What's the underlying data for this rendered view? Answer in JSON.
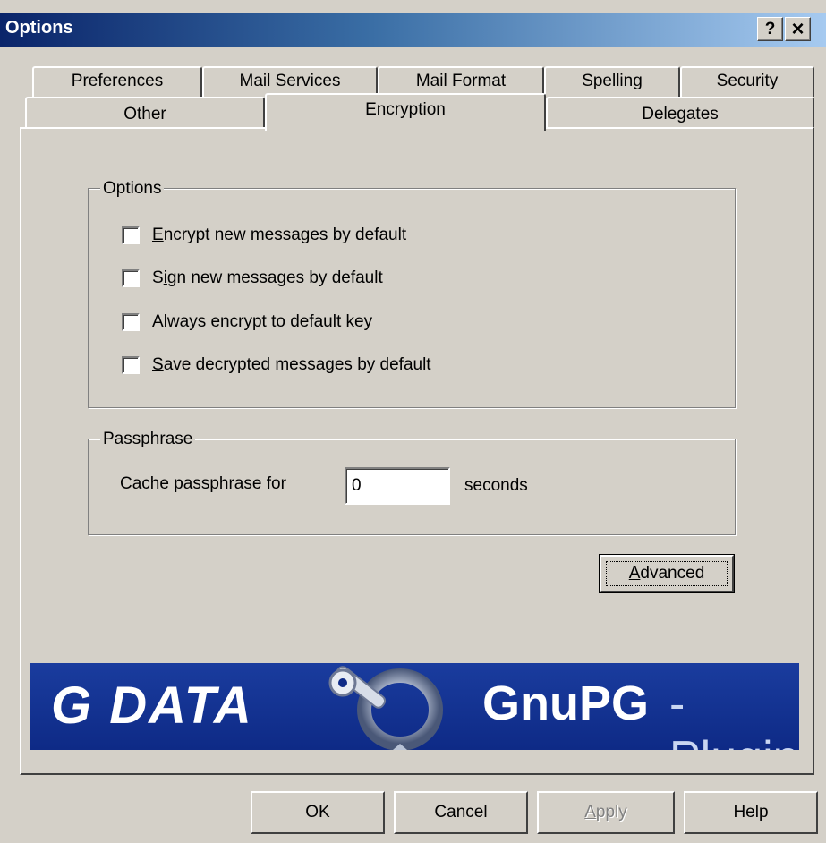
{
  "window": {
    "title": "Options",
    "help_btn": "?",
    "close_btn": "×"
  },
  "tabs_row1": [
    "Preferences",
    "Mail Services",
    "Mail Format",
    "Spelling",
    "Security"
  ],
  "tabs_row2": [
    "Other",
    "Encryption",
    "Delegates"
  ],
  "active_tab": "Encryption",
  "options_group": {
    "legend": "Options",
    "items": [
      {
        "mnemonic": "E",
        "rest": "ncrypt new messages by default",
        "pre": "",
        "checked": false
      },
      {
        "mnemonic": "i",
        "rest": "gn new messages by default",
        "pre": "S",
        "checked": false
      },
      {
        "mnemonic": "l",
        "rest": "ways encrypt to default key",
        "pre": "A",
        "checked": false
      },
      {
        "mnemonic": "S",
        "rest": "ave decrypted messages by default",
        "pre": "",
        "checked": false
      }
    ]
  },
  "passphrase_group": {
    "legend": "Passphrase",
    "cache_label_mnemonic": "C",
    "cache_label_rest": "ache passphrase for",
    "cache_value": "0",
    "unit_label": "seconds"
  },
  "advanced_button": {
    "mnemonic": "A",
    "rest": "dvanced"
  },
  "banner": {
    "left_text": "G DATA",
    "right_text_bold": "GnuPG",
    "right_text_light": "-Plugin"
  },
  "footer": {
    "ok": "OK",
    "cancel": "Cancel",
    "apply_mnemonic": "A",
    "apply_rest": "pply",
    "help": "Help"
  }
}
